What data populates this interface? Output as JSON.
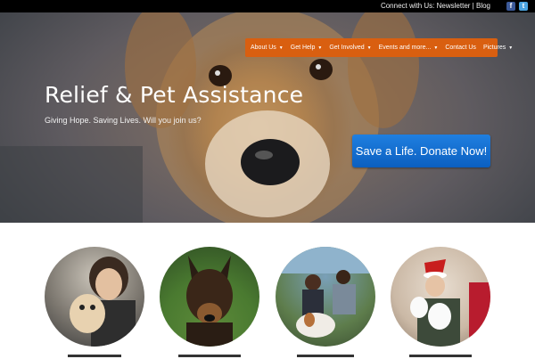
{
  "topbar": {
    "connect_label": "Connect with Us:",
    "links": [
      "Newsletter",
      "Blog"
    ],
    "separator": "|",
    "social": [
      {
        "icon": "facebook-icon",
        "glyph": "f"
      },
      {
        "icon": "twitter-icon",
        "glyph": "t"
      }
    ]
  },
  "nav": {
    "items": [
      {
        "label": "About Us",
        "has_dropdown": true
      },
      {
        "label": "Get Help",
        "has_dropdown": true
      },
      {
        "label": "Get Involved",
        "has_dropdown": true
      },
      {
        "label": "Events and more...",
        "has_dropdown": true
      },
      {
        "label": "Contact Us",
        "has_dropdown": false
      },
      {
        "label": "Pictures",
        "has_dropdown": true
      }
    ],
    "color": "#d95f10"
  },
  "hero": {
    "title": "Relief & Pet Assistance",
    "subtitle": "Giving Hope. Saving Lives. Will you join us?",
    "cta_label": "Save a Life. Donate Now!",
    "cta_color": "#1a73d6"
  },
  "features": [
    {
      "name": "person-with-puppy-photo"
    },
    {
      "name": "german-shepherd-photo"
    },
    {
      "name": "couple-with-dog-photo"
    },
    {
      "name": "santa-hat-with-dogs-photo"
    }
  ]
}
